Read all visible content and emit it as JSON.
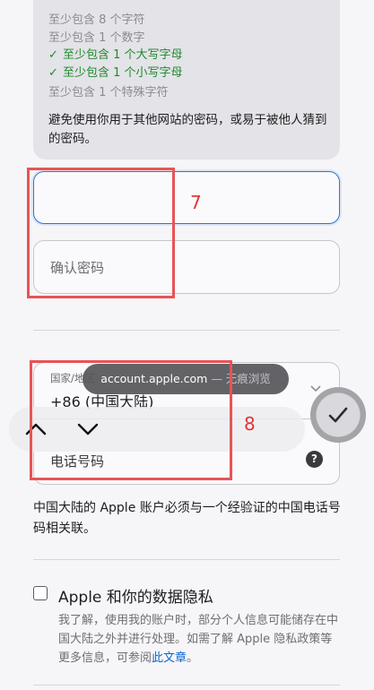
{
  "requirements": [
    {
      "text": "至少包含 8 个字符",
      "met": false
    },
    {
      "text": "至少包含 1 个数字",
      "met": false
    },
    {
      "text": "至少包含 1 个大写字母",
      "met": true
    },
    {
      "text": "至少包含 1 个小写字母",
      "met": true
    },
    {
      "text": "至少包含 1 个特殊字符",
      "met": false
    }
  ],
  "check_mark": "✓",
  "requirements_note": "避免使用你用于其他网站的密码，或易于被他人猜到的密码。",
  "password_field": {
    "value": ""
  },
  "confirm_password": {
    "placeholder": "确认密码"
  },
  "annotations": {
    "box7_label": "7",
    "box8_label": "8"
  },
  "colors": {
    "annotation": "#e85456",
    "focus": "#2f72d6",
    "valid": "#1f8a2c",
    "link": "#0a64d2"
  },
  "toast": {
    "domain": "account.apple.com",
    "mode": "— 无痕浏览"
  },
  "country": {
    "label": "国家/地区",
    "value": "+86 (中国大陆)"
  },
  "phone": {
    "placeholder": "电话号码",
    "help": "?"
  },
  "icons": {
    "prev": "chevron-up-icon",
    "next": "chevron-down-icon",
    "done": "checkmark-icon",
    "select": "chevron-down-icon"
  },
  "phone_note": "中国大陆的 Apple 账户必须与一个经验证的中国电话号码相关联。",
  "privacy": {
    "title": "Apple 和你的数据隐私",
    "description": "我了解，使用我的账户时，部分个人信息可能储存在中国大陆之外并进行处理。如需了解 Apple 隐私政策等更多信息，可参阅",
    "link": "此文章",
    "end": "。",
    "checked": false
  }
}
